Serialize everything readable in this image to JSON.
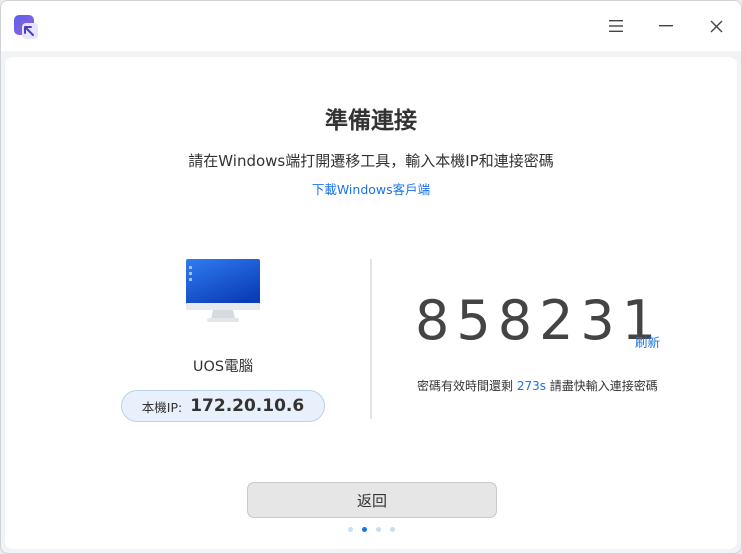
{
  "titlebar": {
    "icons": [
      "app-logo-icon",
      "menu-icon",
      "minimize-icon",
      "close-icon"
    ]
  },
  "main": {
    "title": "準備連接",
    "subtitle": "請在Windows端打開遷移工具，輸入本機IP和連接密碼",
    "download_link": "下載Windows客戶端",
    "device": {
      "name": "UOS電腦",
      "ip_label": "本機IP:",
      "ip_value": "172.20.10.6",
      "icon": "monitor-icon"
    },
    "code": {
      "value": "858231",
      "refresh_label": "刷新",
      "expiry_prefix": "密碼有效時間還剩 ",
      "expiry_seconds": "273s",
      "expiry_suffix": " 請盡快輸入連接密碼"
    },
    "back_button": "返回",
    "pager": {
      "total": 4,
      "active_index": 1
    }
  },
  "colors": {
    "accent": "#1a73e8",
    "pill_bg": "#e8f1fb"
  }
}
